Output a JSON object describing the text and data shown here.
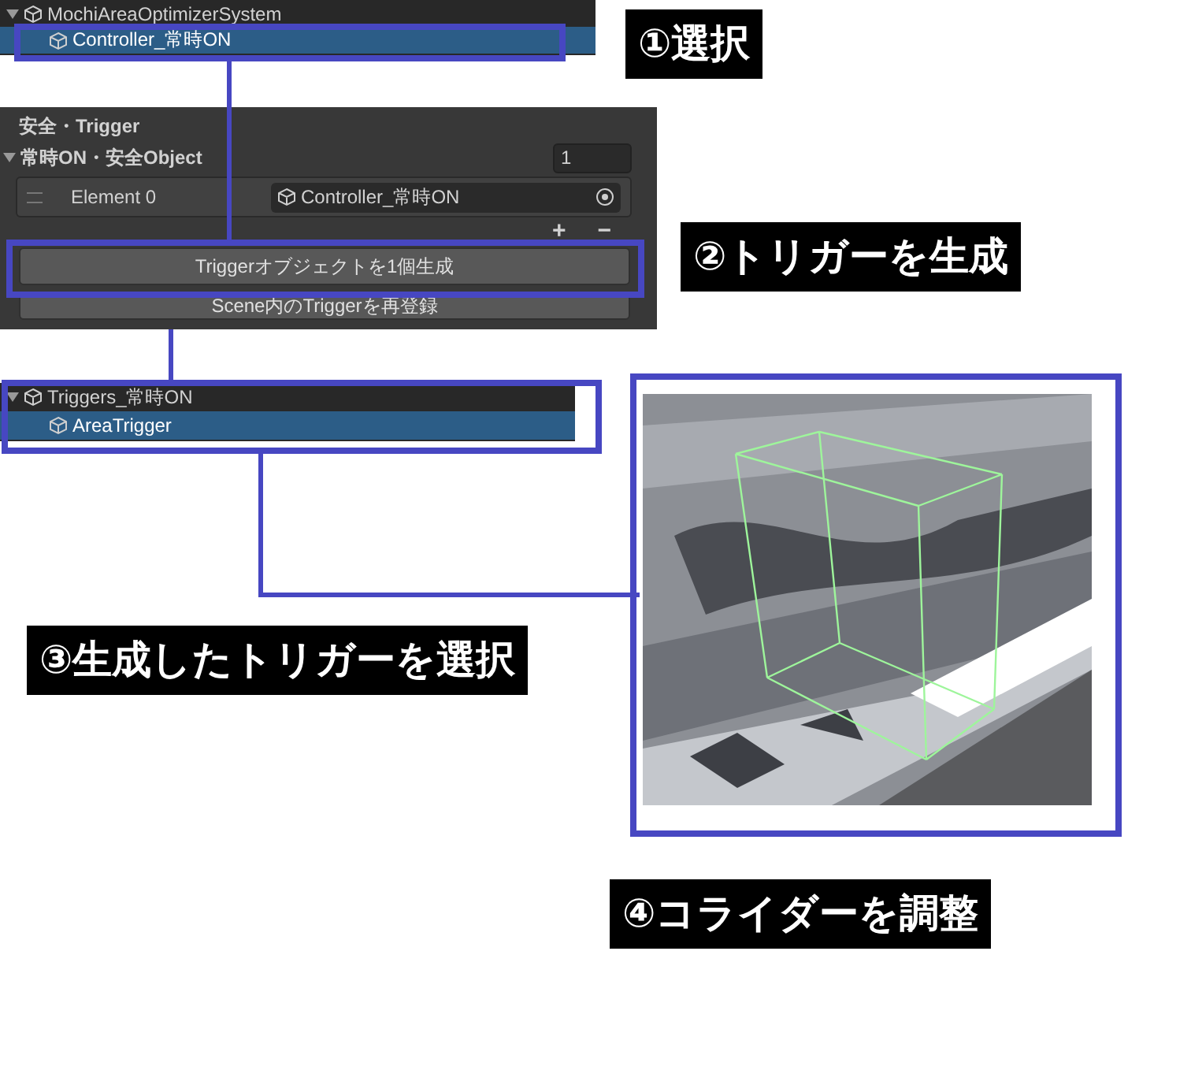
{
  "hierarchy_top": {
    "items": [
      {
        "label": "MochiAreaOptimizerSystem",
        "selected": false,
        "expanded": true,
        "children": [
          {
            "label": "Controller_常時ON",
            "selected": true
          }
        ]
      }
    ]
  },
  "steps": [
    {
      "text": "①選択"
    },
    {
      "text": "②トリガーを生成"
    },
    {
      "text": "③生成したトリガーを選択"
    },
    {
      "text": "④コライダーを調整"
    }
  ],
  "inspector": {
    "section": "安全・Trigger",
    "list": {
      "label": "常時ON・安全Object",
      "expanded": true,
      "size": "1",
      "elements": [
        {
          "label": "Element 0",
          "value": "Controller_常時ON"
        }
      ],
      "add": "+",
      "remove": "−"
    },
    "buttons": [
      {
        "label": "Triggerオブジェクトを1個生成"
      },
      {
        "label": "Scene内のTriggerを再登録"
      }
    ]
  },
  "hierarchy_bottom": {
    "items": [
      {
        "label": "Triggers_常時ON",
        "selected": false,
        "expanded": true,
        "children": [
          {
            "label": "AreaTrigger",
            "selected": true
          }
        ]
      }
    ]
  }
}
